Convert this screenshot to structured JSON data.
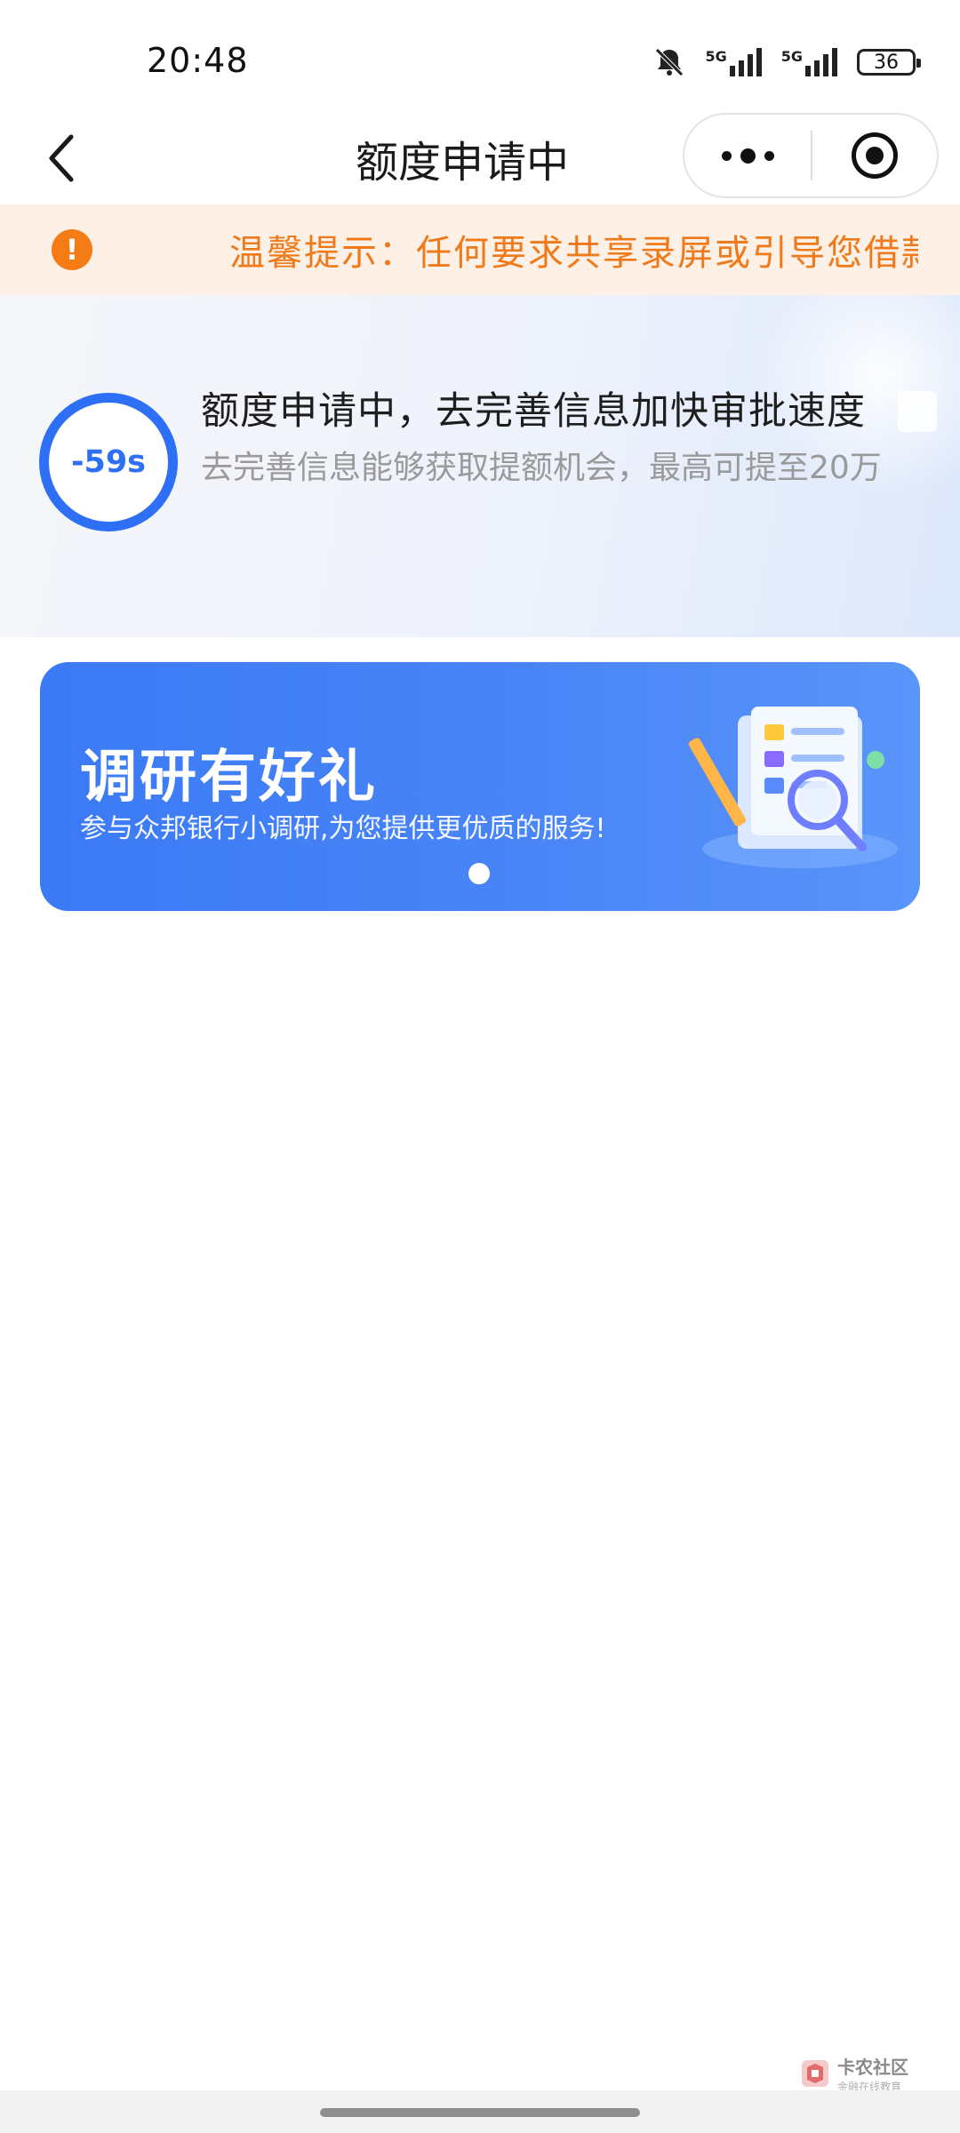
{
  "status_bar": {
    "time": "20:48",
    "network_1": "5G",
    "network_2": "5G",
    "battery": "36"
  },
  "nav": {
    "title": "额度申请中"
  },
  "notice": {
    "text": "温馨提示：任何要求共享录屏或引导您借款"
  },
  "progress": {
    "countdown": "-59s",
    "title": "额度申请中，去完善信息加快审批速度",
    "description": "去完善信息能够获取提额机会，最高可提至20万"
  },
  "banner": {
    "title": "调研有好礼",
    "subtitle": "参与众邦银行小调研,为您提供更优质的服务!"
  },
  "watermark": {
    "main": "卡农社区",
    "sub": "金融在线教育"
  },
  "colors": {
    "accent_blue": "#2d6ff5",
    "notice_orange": "#f07a1a",
    "notice_bg": "#fdf0e6"
  }
}
